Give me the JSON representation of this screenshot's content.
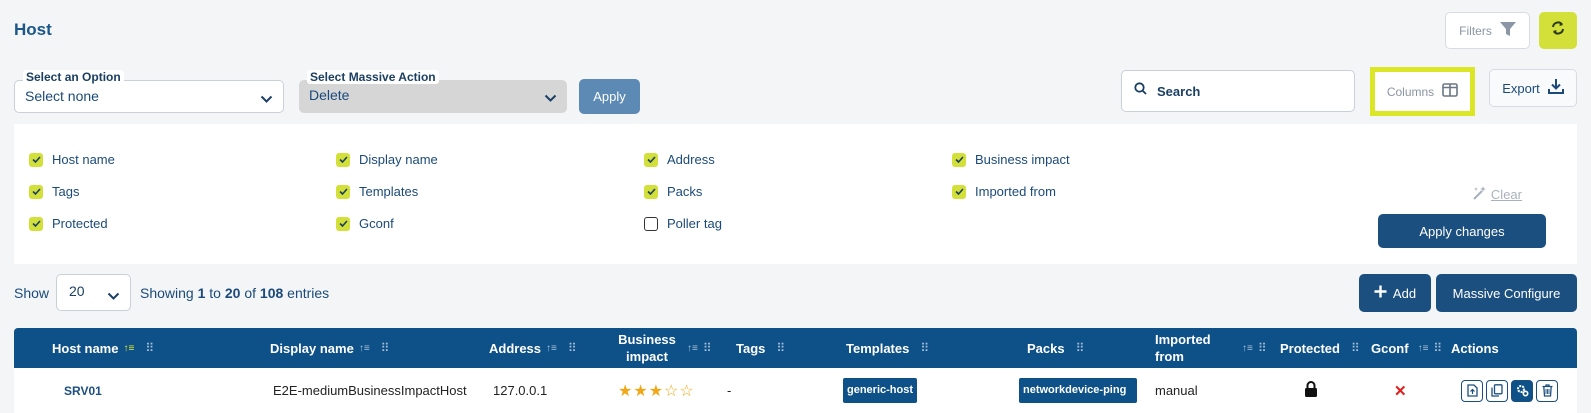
{
  "page": {
    "title": "Host"
  },
  "toolbar": {
    "filters_label": "Filters",
    "refresh_icon": "refresh-icon"
  },
  "option_select": {
    "label": "Select an Option",
    "value": "Select none"
  },
  "massive_select": {
    "label": "Select Massive Action",
    "value": "Delete"
  },
  "apply_label": "Apply",
  "search": {
    "placeholder": "Search"
  },
  "columns_label": "Columns",
  "export_label": "Export",
  "columns_panel": {
    "checkboxes": [
      {
        "label": "Host name",
        "checked": true
      },
      {
        "label": "Display name",
        "checked": true
      },
      {
        "label": "Address",
        "checked": true
      },
      {
        "label": "Business impact",
        "checked": true
      },
      {
        "label": "Tags",
        "checked": true
      },
      {
        "label": "Templates",
        "checked": true
      },
      {
        "label": "Packs",
        "checked": true
      },
      {
        "label": "Imported from",
        "checked": true
      },
      {
        "label": "Protected",
        "checked": true
      },
      {
        "label": "Gconf",
        "checked": true
      },
      {
        "label": "Poller tag",
        "checked": false
      }
    ],
    "clear_label": "Clear",
    "apply_changes_label": "Apply changes"
  },
  "pagination": {
    "show_label": "Show",
    "page_size": "20",
    "entries_prefix": "Showing",
    "from": "1",
    "to_word": "to",
    "to": "20",
    "of_word": "of",
    "total": "108",
    "entries_suffix": "entries"
  },
  "actions": {
    "add_label": "Add",
    "massive_configure_label": "Massive Configure"
  },
  "table": {
    "headers": {
      "host_name": "Host name",
      "display_name": "Display name",
      "address": "Address",
      "business_impact": "Business impact",
      "tags": "Tags",
      "templates": "Templates",
      "packs": "Packs",
      "imported_from": "Imported from",
      "protected": "Protected",
      "gconf": "Gconf",
      "actions": "Actions"
    },
    "rows": [
      {
        "host_name": "SRV01",
        "display_name": "E2E-mediumBusinessImpactHost",
        "address": "127.0.0.1",
        "business_impact": 3,
        "business_impact_max": 5,
        "tags": "-",
        "templates": "generic-host",
        "packs": "networkdevice-ping",
        "imported_from": "manual",
        "protected_icon": "lock-icon",
        "gconf_icon": "x-icon"
      }
    ]
  },
  "colors": {
    "primary": "#0d5188",
    "accent": "#d4e03a",
    "background": "#f4f5f7"
  }
}
